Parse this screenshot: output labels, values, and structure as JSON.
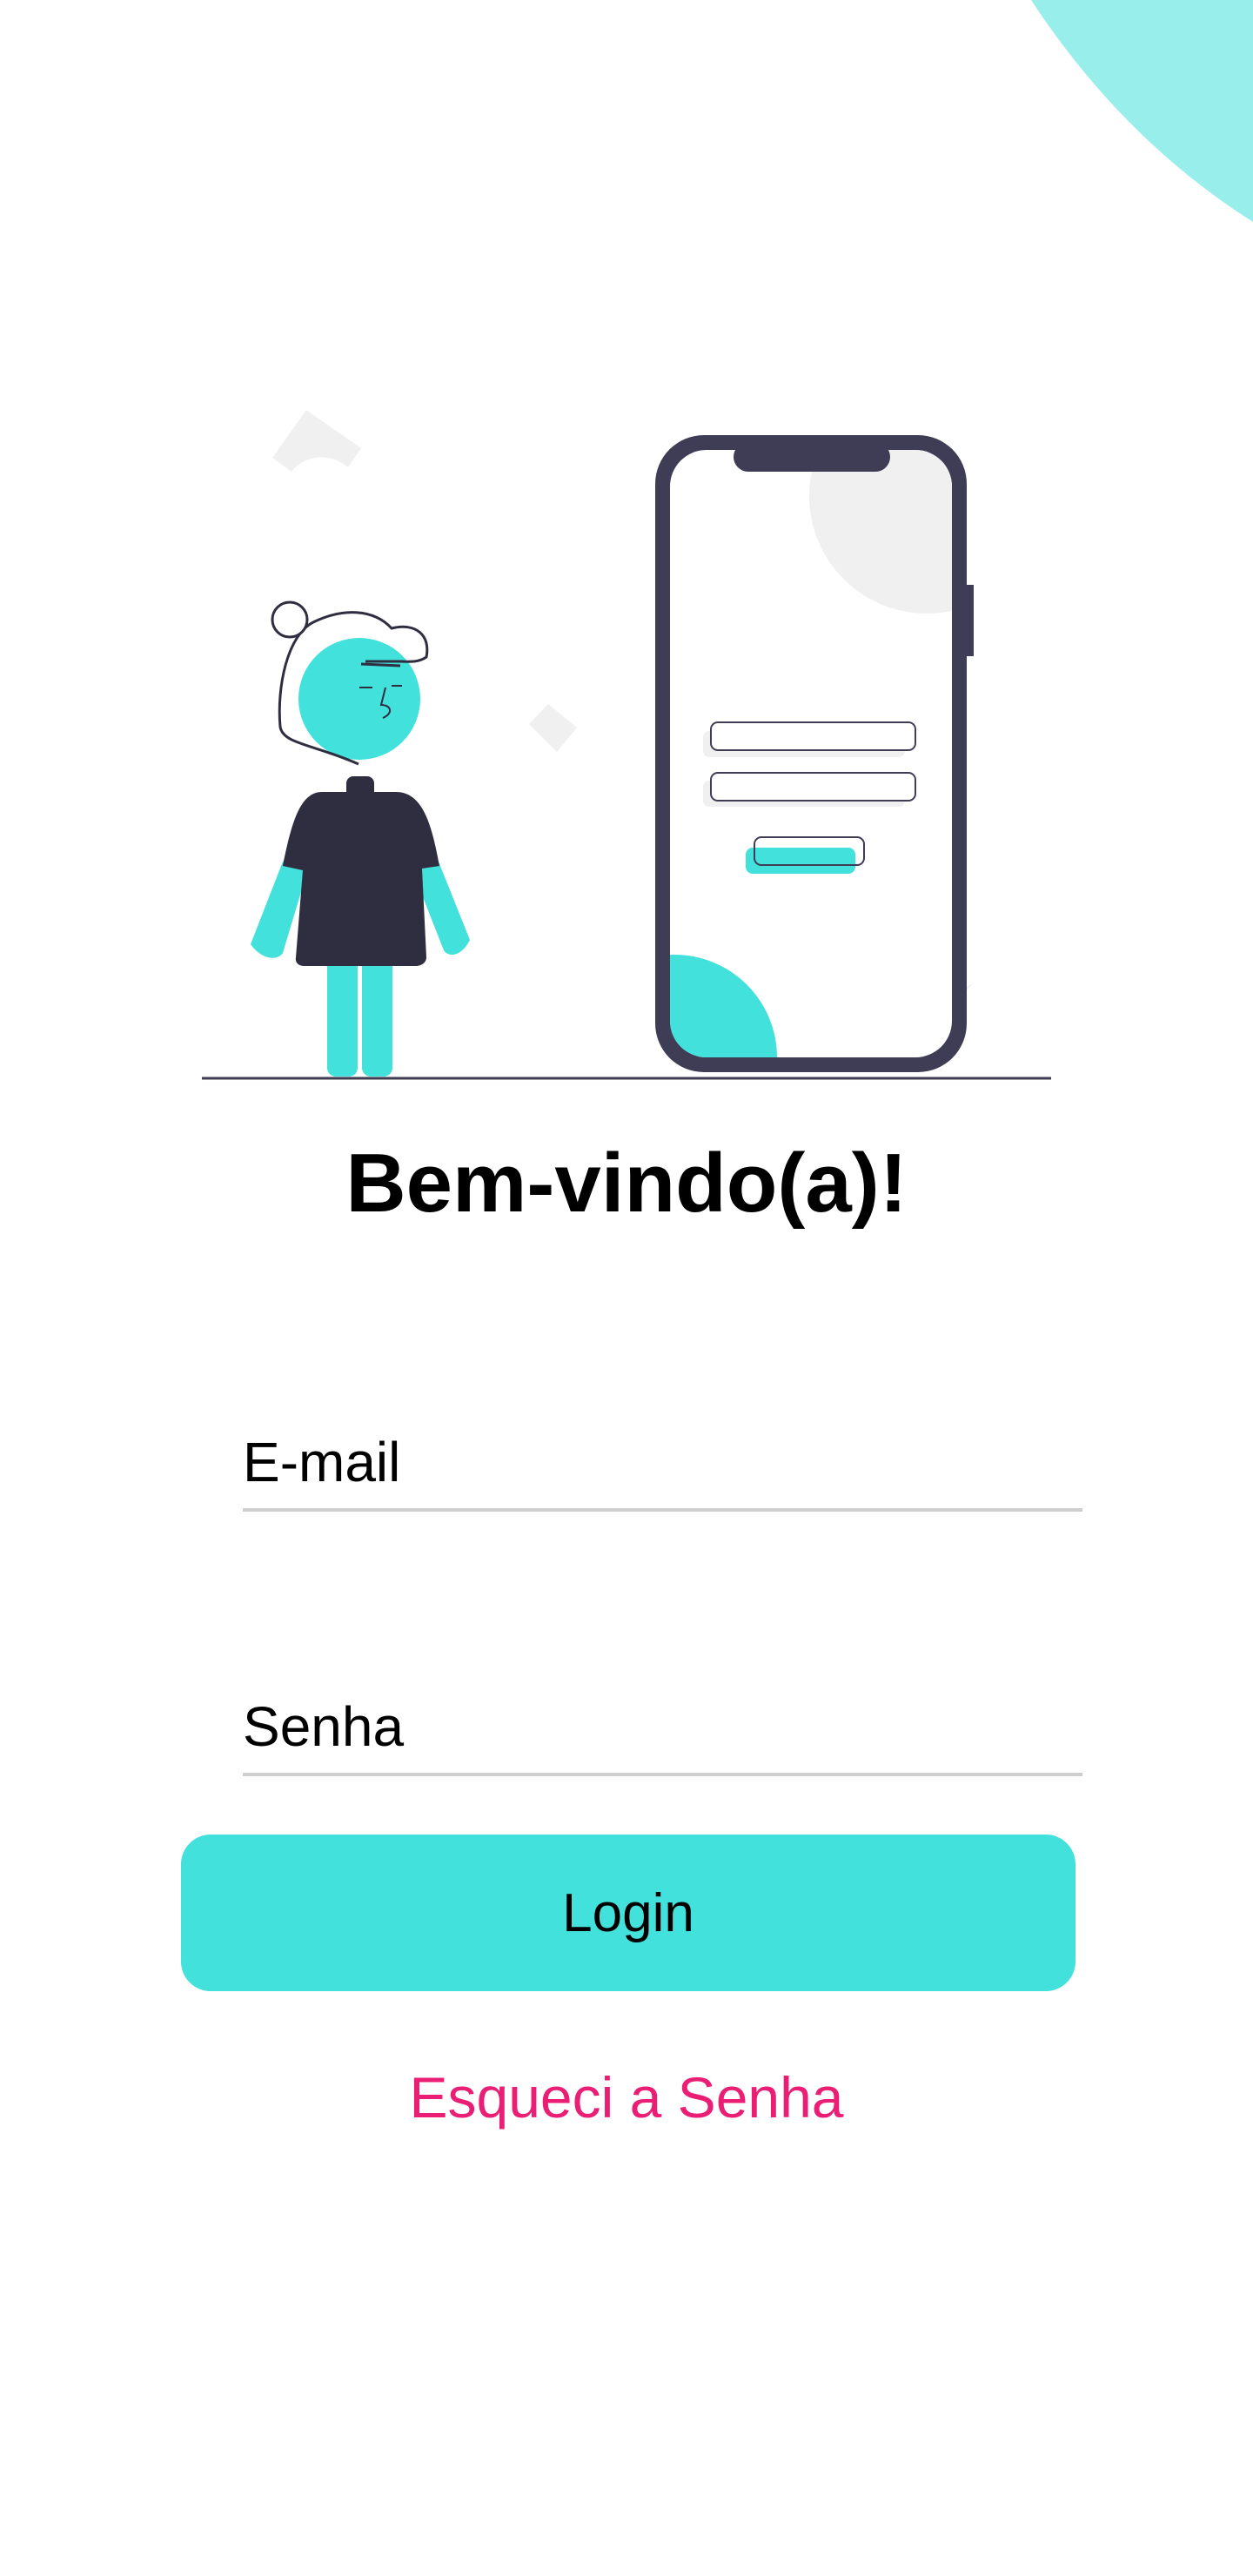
{
  "colors": {
    "accent": "#43e1dc",
    "accent_light": "#98eeeb",
    "link": "#e91e74",
    "dark": "#3f3d56"
  },
  "illustration": {
    "icon": "person-with-phone-login-illustration"
  },
  "welcome": {
    "title": "Bem-vindo(a)!"
  },
  "form": {
    "email_placeholder": "E-mail",
    "password_placeholder": "Senha",
    "login_label": "Login",
    "forgot_label": "Esqueci a Senha"
  }
}
